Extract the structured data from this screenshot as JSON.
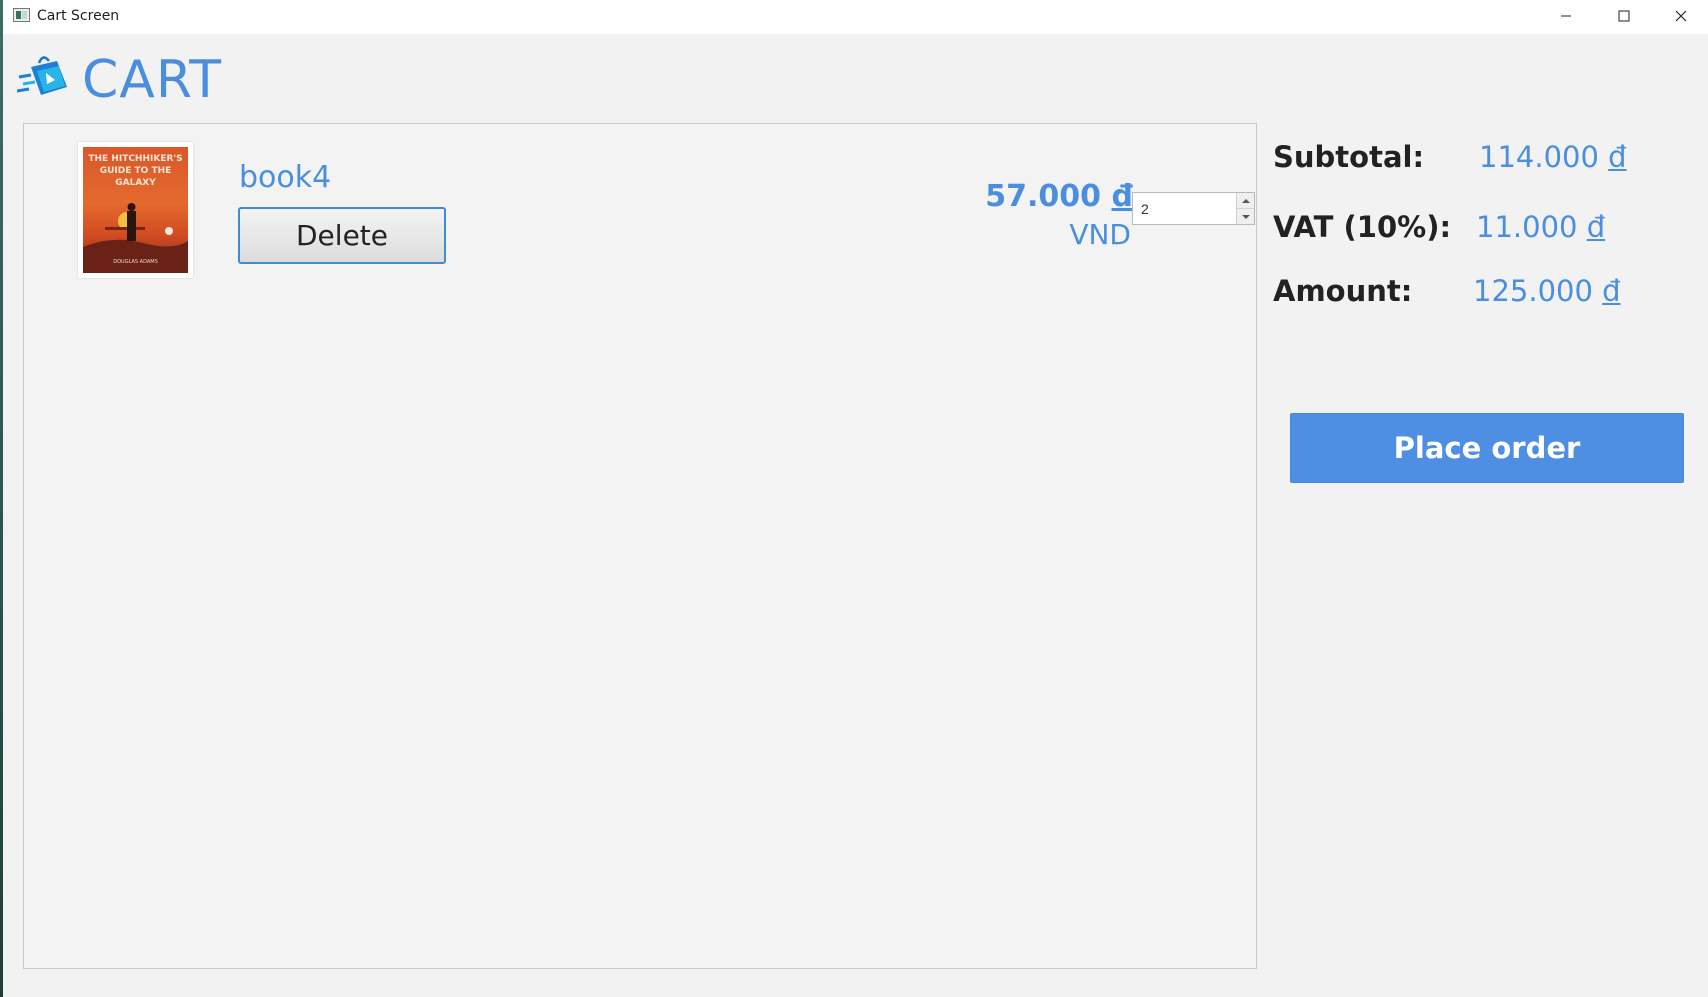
{
  "window": {
    "title": "Cart Screen"
  },
  "header": {
    "title": "CART",
    "logo_icon": "shopping-bag-icon"
  },
  "cart": {
    "items": [
      {
        "name": "book4",
        "delete_label": "Delete",
        "price": "57.000",
        "currency_symbol": "đ",
        "currency_code": "VND",
        "quantity": "2",
        "cover_title": "THE HITCHHIKER'S GUIDE TO THE GALAXY",
        "cover_author": "DOUGLAS ADAMS"
      }
    ]
  },
  "summary": {
    "subtotal_label": "Subtotal:",
    "subtotal_value": "114.000",
    "vat_label": "VAT (10%):",
    "vat_value": "11.000",
    "amount_label": "Amount:",
    "amount_value": "125.000",
    "currency_symbol": "đ",
    "place_order_label": "Place order"
  },
  "colors": {
    "accent": "#4c8ede",
    "button_primary": "#4f8fe3",
    "background": "#f2f2f2"
  }
}
